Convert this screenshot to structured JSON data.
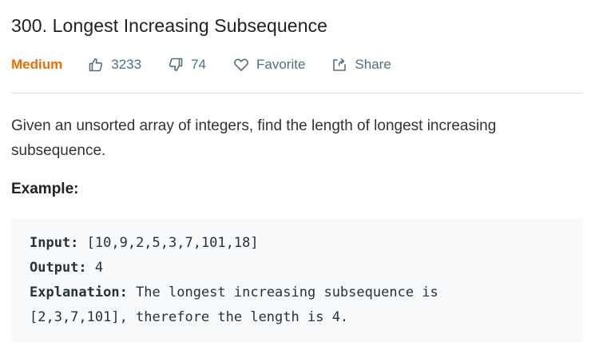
{
  "problem": {
    "title": "300. Longest Increasing Subsequence",
    "difficulty": "Medium",
    "likes": "3233",
    "dislikes": "74",
    "favorite_label": "Favorite",
    "share_label": "Share",
    "description": "Given an unsorted array of integers, find the length of longest increasing subsequence.",
    "example_heading": "Example:",
    "example": {
      "input_label": "Input:",
      "input_value": " [10,9,2,5,3,7,101,18]",
      "output_label": "Output:",
      "output_value": " 4",
      "explanation_label": "Explanation:",
      "explanation_line1": " The longest increasing subsequence is",
      "explanation_line2": "[2,3,7,101], therefore the length is 4."
    }
  },
  "colors": {
    "difficulty_medium": "#ef6c00",
    "meta_text": "#546e7a",
    "code_background": "#f7f9fa"
  },
  "icons": {
    "likes": "thumbs-up-icon",
    "dislikes": "thumbs-down-icon",
    "favorite": "heart-icon",
    "share": "share-icon"
  }
}
